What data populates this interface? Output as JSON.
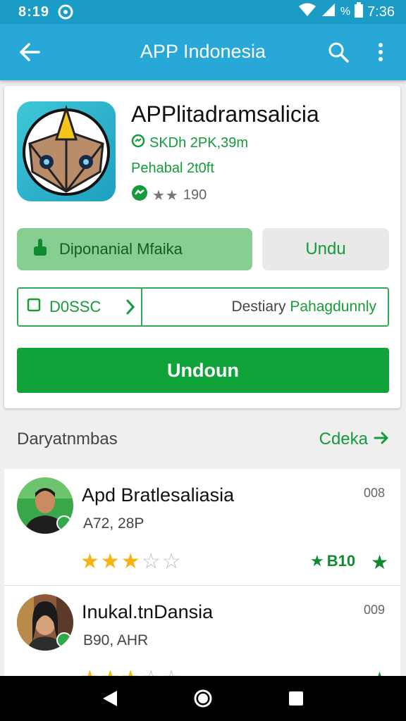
{
  "status_bar": {
    "time": "8:19",
    "battery_time": "7:36"
  },
  "app_bar": {
    "title": "APP Indonesia"
  },
  "app": {
    "name": "APPlitadramsalicia",
    "size": "SKDh 2PK,39m",
    "publisher": "Pehabal 2t0ft",
    "rating_count": "190",
    "rating_stars_shown": 2
  },
  "buttons": {
    "primary_light": "Diponanial Mfaika",
    "secondary": "Undu",
    "split_left": "D0SSC",
    "split_right_gray": "Destiary",
    "split_right_green": "Pahagdunnly",
    "main": "Undoun"
  },
  "section": {
    "title": "Daryatnmbas",
    "link": "Cdeka"
  },
  "list": [
    {
      "title": "Apd Bratlesaliasia",
      "subtitle": "A72, 28P",
      "count": "008",
      "stars": 3,
      "rating": "B10"
    },
    {
      "title": "Inukal.tnDansia",
      "subtitle": "B90, AHR",
      "count": "009",
      "stars": 3,
      "rating": ""
    }
  ],
  "colors": {
    "status_bar": "#1a9cc7",
    "app_bar": "#27a8d6",
    "green": "#0fa33a",
    "star": "#f5b414"
  },
  "icons": [
    "back-arrow-icon",
    "search-icon",
    "more-vert-icon",
    "app-logo-icon",
    "hand-icon",
    "checkbox-icon",
    "chevron-right-icon",
    "arrow-right-icon",
    "verified-badge-icon",
    "star-icon",
    "nav-back-icon",
    "nav-home-icon",
    "nav-recents-icon"
  ]
}
